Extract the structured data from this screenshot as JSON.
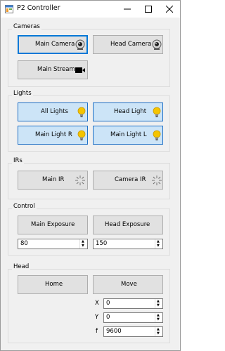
{
  "window": {
    "title": "P2 Controller"
  },
  "cameras": {
    "label": "Cameras",
    "main_camera": "Main Camera",
    "head_camera": "Head Camera",
    "main_stream": "Main Stream"
  },
  "lights": {
    "label": "Lights",
    "all_lights": "All Lights",
    "head_light": "Head Light",
    "main_light_r": "Main Light R",
    "main_light_l": "Main Light L"
  },
  "irs": {
    "label": "IRs",
    "main_ir": "Main IR",
    "camera_ir": "Camera IR"
  },
  "control": {
    "label": "Control",
    "main_exposure": "Main Exposure",
    "head_exposure": "Head Exposure",
    "main_exposure_value": "80",
    "head_exposure_value": "150"
  },
  "head": {
    "label": "Head",
    "home": "Home",
    "move": "Move",
    "x_label": "X",
    "x_value": "0",
    "y_label": "Y",
    "y_value": "0",
    "f_label": "f",
    "f_value": "9600"
  },
  "icons": {
    "camera": "webcam-icon",
    "stream": "video-camera-icon",
    "light": "lightbulb-icon",
    "ir": "ir-sparkle-icon"
  },
  "colors": {
    "accent": "#0078d7",
    "light_button": "#cce4f7",
    "bulb": "#f5c400"
  }
}
